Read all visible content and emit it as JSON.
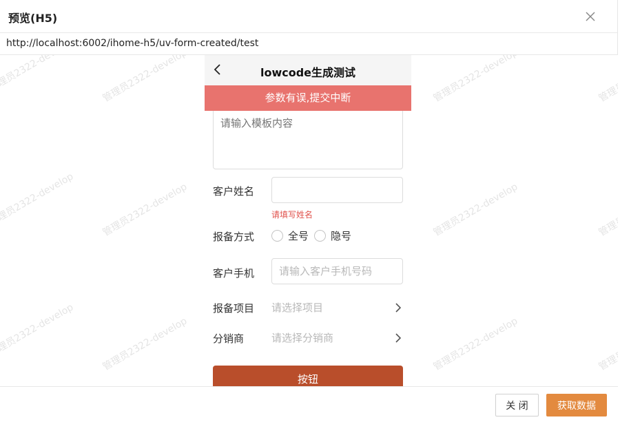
{
  "dialog": {
    "title": "预览(H5)",
    "url": "http://localhost:6002/ihome-h5/uv-form-created/test"
  },
  "watermark": {
    "text": "管理员2322-develop"
  },
  "phone": {
    "nav_title": "lowcode生成测试",
    "toast": "参数有误,提交中断",
    "template_placeholder": "请输入模板内容",
    "fields": {
      "customer_name_label": "客户姓名",
      "customer_name_error": "请填写姓名",
      "report_method_label": "报备方式",
      "report_method_options": [
        "全号",
        "隐号"
      ],
      "customer_phone_label": "客户手机",
      "customer_phone_placeholder": "请输入客户手机号码",
      "project_label": "报备项目",
      "project_placeholder": "请选择项目",
      "distributor_label": "分销商",
      "distributor_placeholder": "请选择分销商"
    },
    "submit_label": "按钮"
  },
  "footer": {
    "close_label": "关 闭",
    "fetch_label": "获取数据"
  },
  "colors": {
    "toast_bg": "#e8736e",
    "submit_bg": "#b94e2b",
    "fetch_bg": "#e38a3f",
    "error_text": "#e0524c"
  },
  "icons": [
    "close-icon",
    "back-arrow-icon",
    "chevron-right-icon"
  ]
}
